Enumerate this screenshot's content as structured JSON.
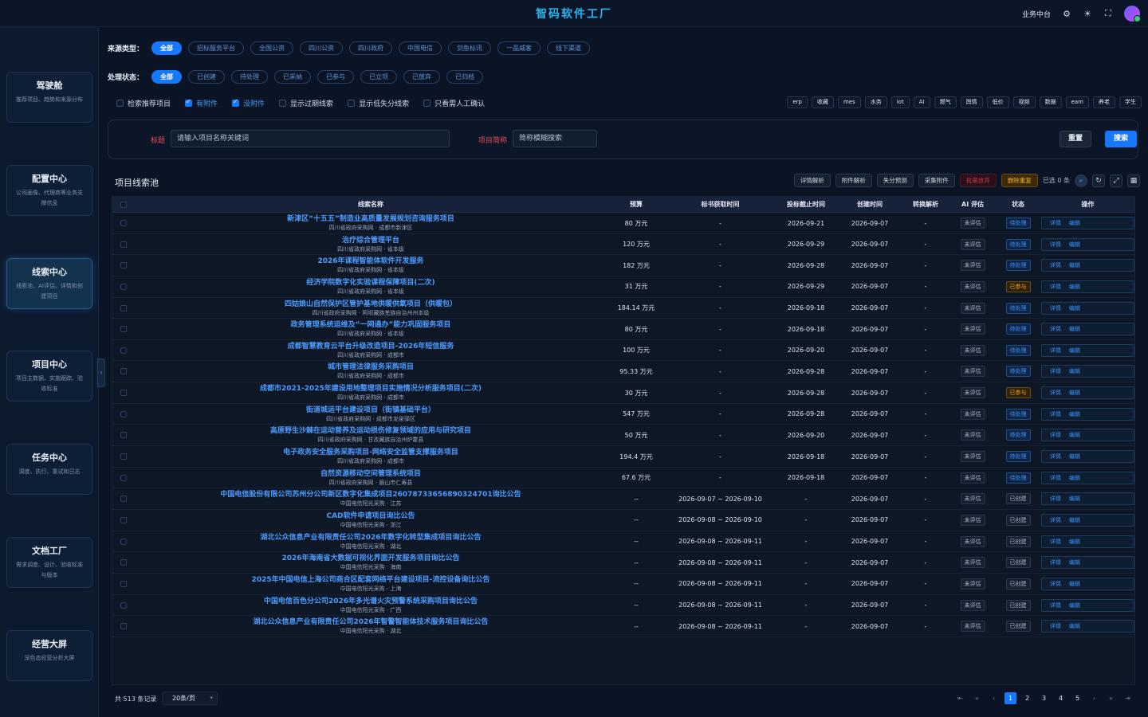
{
  "app": {
    "title": "智码软件工厂"
  },
  "topbar": {
    "business_link": "业务中台",
    "icons": [
      "gear-icon",
      "sun-icon",
      "fullscreen-icon",
      "avatar"
    ]
  },
  "sidebar": {
    "items": [
      {
        "title": "驾驶舱",
        "desc": "推荐项目、趋势和来源分布"
      },
      {
        "title": "配置中心",
        "desc": "公司画像、代理商等业务支撑信息"
      },
      {
        "title": "线索中心",
        "desc": "线索池、AI评估、详情和创建项目",
        "active": true
      },
      {
        "title": "项目中心",
        "desc": "项目主数据、实施跟踪、验收标准"
      },
      {
        "title": "任务中心",
        "desc": "调度、执行、重试和日志"
      },
      {
        "title": "文档工厂",
        "desc": "需求调查、设计、验收标准与版本"
      },
      {
        "title": "经营大屏",
        "desc": "深色态经营分析大屏"
      }
    ]
  },
  "filters": {
    "source_label": "来源类型：",
    "source_options": [
      "全部",
      "招标服务平台",
      "全国公资",
      "四川公资",
      "四川政府",
      "中国电信",
      "剑鱼标讯",
      "一品威客",
      "线下渠道"
    ],
    "status_label": "处理状态：",
    "status_options": [
      "全部",
      "已创建",
      "待处理",
      "已采纳",
      "已参与",
      "已立项",
      "已放弃",
      "已归档"
    ],
    "checks": [
      {
        "label": "检索推荐项目",
        "checked": false
      },
      {
        "label": "有附件",
        "checked": true
      },
      {
        "label": "没附件",
        "checked": true
      },
      {
        "label": "显示过期线索",
        "checked": false
      },
      {
        "label": "显示低失分线索",
        "checked": false
      },
      {
        "label": "只看需人工确认",
        "checked": false
      }
    ],
    "tags": [
      "erp",
      "收藏",
      "mes",
      "水务",
      "iot",
      "AI",
      "燃气",
      "舆情",
      "低价",
      "视频",
      "数据",
      "eam",
      "养老",
      "学生"
    ]
  },
  "search": {
    "title_label": "标题",
    "title_placeholder": "请输入项目名称关键词",
    "short_label": "项目简称",
    "short_placeholder": "简称模糊搜索",
    "reset_label": "重置",
    "search_label": "搜索"
  },
  "pool": {
    "title": "项目线索池",
    "toolbar": [
      "详情解析",
      "附件解析",
      "失分预测",
      "采集附件"
    ],
    "batch_abandon": "批量放弃",
    "dedupe": "删除重复",
    "selected_text": "已选 0 条"
  },
  "table": {
    "headers": [
      "线索名称",
      "预算",
      "标书获取时间",
      "投标截止时间",
      "创建时间",
      "转换解析",
      "AI 评估",
      "状态",
      "操作"
    ],
    "ops": [
      "详情",
      "编辑"
    ],
    "rows": [
      {
        "name": "新津区“十五五”制造业高质量发展规划咨询服务项目",
        "source": "四川省政府采购网 · 成都市新津区",
        "budget": "80 万元",
        "obtain": "-",
        "deadline": "2026-09-21",
        "created": "2026-09-07",
        "convert": "-",
        "ai": "未评估",
        "status": "待处理",
        "status_type": "blue"
      },
      {
        "name": "治疗综合管理平台",
        "source": "四川省政府采购网 · 省本级",
        "budget": "120 万元",
        "obtain": "-",
        "deadline": "2026-09-29",
        "created": "2026-09-07",
        "convert": "-",
        "ai": "未评估",
        "status": "待处理",
        "status_type": "blue"
      },
      {
        "name": "2026年课程智能体软件开发服务",
        "source": "四川省政府采购网 · 省本级",
        "budget": "182 万元",
        "obtain": "-",
        "deadline": "2026-09-28",
        "created": "2026-09-07",
        "convert": "-",
        "ai": "未评估",
        "status": "待处理",
        "status_type": "blue"
      },
      {
        "name": "经济学院数字化实验课程保障项目(二次)",
        "source": "四川省政府采购网 · 省本级",
        "budget": "31 万元",
        "obtain": "-",
        "deadline": "2026-09-29",
        "created": "2026-09-07",
        "convert": "-",
        "ai": "未评估",
        "status": "已参与",
        "status_type": "orange"
      },
      {
        "name": "四姑娘山自然保护区管护基地供暖供氧项目（供暖包）",
        "source": "四川省政府采购网 · 阿坝藏族羌族自治州州本级",
        "budget": "184.14 万元",
        "obtain": "-",
        "deadline": "2026-09-18",
        "created": "2026-09-07",
        "convert": "-",
        "ai": "未评估",
        "status": "待处理",
        "status_type": "blue"
      },
      {
        "name": "政务管理系统运维及“一网通办”能力巩固服务项目",
        "source": "四川省政府采购网 · 省本级",
        "budget": "80 万元",
        "obtain": "-",
        "deadline": "2026-09-18",
        "created": "2026-09-07",
        "convert": "-",
        "ai": "未评估",
        "status": "待处理",
        "status_type": "blue"
      },
      {
        "name": "成都智慧教育云平台升级改造项目-2026年短信服务",
        "source": "四川省政府采购网 · 成都市",
        "budget": "100 万元",
        "obtain": "-",
        "deadline": "2026-09-20",
        "created": "2026-09-07",
        "convert": "-",
        "ai": "未评估",
        "status": "待处理",
        "status_type": "blue"
      },
      {
        "name": "城市管理法律服务采购项目",
        "source": "四川省政府采购网 · 成都市",
        "budget": "95.33 万元",
        "obtain": "-",
        "deadline": "2026-09-28",
        "created": "2026-09-07",
        "convert": "-",
        "ai": "未评估",
        "status": "待处理",
        "status_type": "blue"
      },
      {
        "name": "成都市2021-2025年建设用地整理项目实施情况分析服务项目(二次)",
        "source": "四川省政府采购网 · 成都市",
        "budget": "30 万元",
        "obtain": "-",
        "deadline": "2026-09-28",
        "created": "2026-09-07",
        "convert": "-",
        "ai": "未评估",
        "status": "已参与",
        "status_type": "orange"
      },
      {
        "name": "街道城运平台建设项目（街镇基础平台）",
        "source": "四川省政府采购网 · 成都市龙泉驿区",
        "budget": "547 万元",
        "obtain": "-",
        "deadline": "2026-09-28",
        "created": "2026-09-07",
        "convert": "-",
        "ai": "未评估",
        "status": "待处理",
        "status_type": "blue"
      },
      {
        "name": "高原野生沙棘在运动营养及运动损伤修复领域的应用与研究项目",
        "source": "四川省政府采购网 · 甘孜藏族自治州炉霍县",
        "budget": "50 万元",
        "obtain": "-",
        "deadline": "2026-09-20",
        "created": "2026-09-07",
        "convert": "-",
        "ai": "未评估",
        "status": "待处理",
        "status_type": "blue"
      },
      {
        "name": "电子政务安全服务采购项目-网络安全监管支撑服务项目",
        "source": "四川省政府采购网 · 成都市",
        "budget": "194.4 万元",
        "obtain": "-",
        "deadline": "2026-09-18",
        "created": "2026-09-07",
        "convert": "-",
        "ai": "未评估",
        "status": "待处理",
        "status_type": "blue"
      },
      {
        "name": "自然资源移动空间管理系统项目",
        "source": "四川省政府采购网 · 眉山市仁寿县",
        "budget": "67.6 万元",
        "obtain": "-",
        "deadline": "2026-09-18",
        "created": "2026-09-07",
        "convert": "-",
        "ai": "未评估",
        "status": "待处理",
        "status_type": "blue"
      },
      {
        "name": "中国电信股份有限公司苏州分公司新区数字化集成项目2607873365689032470​1询比公告",
        "source": "中国电信阳光采购 · 江苏",
        "budget": "--",
        "obtain": "2026-09-07 ~ 2026-09-10",
        "deadline": "-",
        "created": "2026-09-07",
        "convert": "-",
        "ai": "未评估",
        "status": "已创建",
        "status_type": "gray"
      },
      {
        "name": "CAD软件申请项目询比公告",
        "source": "中国电信阳光采购 · 浙江",
        "budget": "--",
        "obtain": "2026-09-08 ~ 2026-09-10",
        "deadline": "-",
        "created": "2026-09-07",
        "convert": "-",
        "ai": "未评估",
        "status": "已创建",
        "status_type": "gray"
      },
      {
        "name": "湖北公众信息产业有限责任公司2026年数字化转型集成项目询比公告",
        "source": "中国电信阳光采购 · 湖北",
        "budget": "--",
        "obtain": "2026-09-08 ~ 2026-09-11",
        "deadline": "-",
        "created": "2026-09-07",
        "convert": "-",
        "ai": "未评估",
        "status": "已创建",
        "status_type": "gray"
      },
      {
        "name": "2026年海南省大数据可视化界面开发服务项目询比公告",
        "source": "中国电信阳光采购 · 海南",
        "budget": "--",
        "obtain": "2026-09-08 ~ 2026-09-11",
        "deadline": "-",
        "created": "2026-09-07",
        "convert": "-",
        "ai": "未评估",
        "status": "已创建",
        "status_type": "gray"
      },
      {
        "name": "2025年中国电信上海公司商合区配套网络平台建设项目-流控设备询比公告",
        "source": "中国电信阳光采购 · 上海",
        "budget": "--",
        "obtain": "2026-09-08 ~ 2026-09-11",
        "deadline": "-",
        "created": "2026-09-07",
        "convert": "-",
        "ai": "未评估",
        "status": "已创建",
        "status_type": "gray"
      },
      {
        "name": "中国电信百色分公司2026年多光谱火灾预警系统采购项目询比公告",
        "source": "中国电信阳光采购 · 广西",
        "budget": "--",
        "obtain": "2026-09-08 ~ 2026-09-11",
        "deadline": "-",
        "created": "2026-09-07",
        "convert": "-",
        "ai": "未评估",
        "status": "已创建",
        "status_type": "gray"
      },
      {
        "name": "湖北公众信息产业有限责任公司2026年智警智能体技术服务项目询比公告",
        "source": "中国电信阳光采购 · 湖北",
        "budget": "--",
        "obtain": "2026-09-08 ~ 2026-09-11",
        "deadline": "-",
        "created": "2026-09-07",
        "convert": "-",
        "ai": "未评估",
        "status": "已创建",
        "status_type": "gray"
      }
    ]
  },
  "footer": {
    "total": "共 513 条记录",
    "page_size": "20条/页",
    "pages": [
      "1",
      "2",
      "3",
      "4",
      "5"
    ],
    "current_page": "1"
  }
}
